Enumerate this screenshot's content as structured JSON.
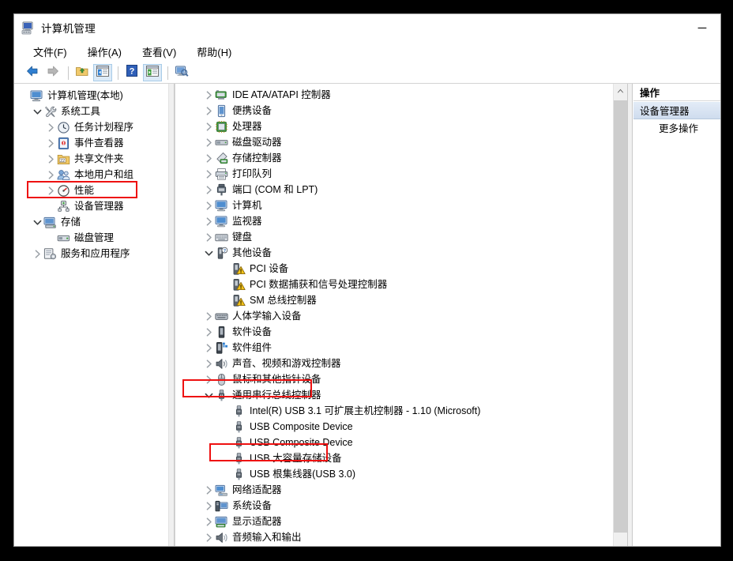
{
  "window": {
    "title": "计算机管理",
    "icon": "computer-management-icon",
    "minimize_label": "─"
  },
  "menu": [
    {
      "name": "file",
      "label": "文件(F)",
      "accel": "F"
    },
    {
      "name": "action",
      "label": "操作(A)",
      "accel": "A"
    },
    {
      "name": "view",
      "label": "查看(V)",
      "accel": "V"
    },
    {
      "name": "help",
      "label": "帮助(H)",
      "accel": "H"
    }
  ],
  "toolbar": [
    {
      "name": "back-icon",
      "tooltip": "后退"
    },
    {
      "name": "forward-icon",
      "tooltip": "前进"
    },
    {
      "name": "up-folder-icon",
      "tooltip": "向上一层"
    },
    {
      "name": "show-console-tree-icon",
      "tooltip": "显示/隐藏控制台树",
      "active": true
    },
    {
      "name": "help-icon",
      "tooltip": "帮助"
    },
    {
      "name": "show-action-pane-icon",
      "tooltip": "显示/隐藏操作窗格",
      "active": true
    },
    {
      "name": "scan-hardware-icon",
      "tooltip": "扫描检测硬件改动"
    }
  ],
  "console_tree": [
    {
      "label": "计算机管理(本地)",
      "depth": 0,
      "state": "none",
      "icon": "computer-management-icon"
    },
    {
      "label": "系统工具",
      "depth": 1,
      "state": "expanded",
      "icon": "system-tools-icon"
    },
    {
      "label": "任务计划程序",
      "depth": 2,
      "state": "collapsed",
      "icon": "task-scheduler-icon"
    },
    {
      "label": "事件查看器",
      "depth": 2,
      "state": "collapsed",
      "icon": "event-viewer-icon"
    },
    {
      "label": "共享文件夹",
      "depth": 2,
      "state": "collapsed",
      "icon": "shared-folders-icon"
    },
    {
      "label": "本地用户和组",
      "depth": 2,
      "state": "collapsed",
      "icon": "local-users-groups-icon"
    },
    {
      "label": "性能",
      "depth": 2,
      "state": "collapsed",
      "icon": "performance-icon"
    },
    {
      "label": "设备管理器",
      "depth": 2,
      "state": "none",
      "icon": "device-manager-icon",
      "highlighted": true
    },
    {
      "label": "存储",
      "depth": 1,
      "state": "expanded",
      "icon": "storage-icon"
    },
    {
      "label": "磁盘管理",
      "depth": 2,
      "state": "none",
      "icon": "disk-management-icon"
    },
    {
      "label": "服务和应用程序",
      "depth": 1,
      "state": "collapsed",
      "icon": "services-applications-icon"
    }
  ],
  "device_tree": [
    {
      "label": "IDE ATA/ATAPI 控制器",
      "depth": 1,
      "state": "collapsed",
      "icon": "ide-controller-icon"
    },
    {
      "label": "便携设备",
      "depth": 1,
      "state": "collapsed",
      "icon": "portable-device-icon"
    },
    {
      "label": "处理器",
      "depth": 1,
      "state": "collapsed",
      "icon": "processor-icon"
    },
    {
      "label": "磁盘驱动器",
      "depth": 1,
      "state": "collapsed",
      "icon": "disk-drive-icon"
    },
    {
      "label": "存储控制器",
      "depth": 1,
      "state": "collapsed",
      "icon": "storage-controller-icon"
    },
    {
      "label": "打印队列",
      "depth": 1,
      "state": "collapsed",
      "icon": "print-queue-icon"
    },
    {
      "label": "端口 (COM 和 LPT)",
      "depth": 1,
      "state": "collapsed",
      "icon": "port-icon"
    },
    {
      "label": "计算机",
      "depth": 1,
      "state": "collapsed",
      "icon": "computer-icon"
    },
    {
      "label": "监视器",
      "depth": 1,
      "state": "collapsed",
      "icon": "monitor-icon"
    },
    {
      "label": "键盘",
      "depth": 1,
      "state": "collapsed",
      "icon": "keyboard-icon"
    },
    {
      "label": "其他设备",
      "depth": 1,
      "state": "expanded",
      "icon": "other-devices-icon"
    },
    {
      "label": "PCI 设备",
      "depth": 2,
      "state": "none",
      "icon": "unknown-device-warning-icon"
    },
    {
      "label": "PCI 数据捕获和信号处理控制器",
      "depth": 2,
      "state": "none",
      "icon": "unknown-device-warning-icon"
    },
    {
      "label": "SM 总线控制器",
      "depth": 2,
      "state": "none",
      "icon": "unknown-device-warning-icon"
    },
    {
      "label": "人体学输入设备",
      "depth": 1,
      "state": "collapsed",
      "icon": "hid-icon"
    },
    {
      "label": "软件设备",
      "depth": 1,
      "state": "collapsed",
      "icon": "software-device-icon"
    },
    {
      "label": "软件组件",
      "depth": 1,
      "state": "collapsed",
      "icon": "software-component-icon"
    },
    {
      "label": "声音、视频和游戏控制器",
      "depth": 1,
      "state": "collapsed",
      "icon": "sound-video-game-icon"
    },
    {
      "label": "鼠标和其他指针设备",
      "depth": 1,
      "state": "collapsed",
      "icon": "mouse-icon"
    },
    {
      "label": "通用串行总线控制器",
      "depth": 1,
      "state": "expanded",
      "icon": "usb-icon",
      "highlighted": true
    },
    {
      "label": "Intel(R) USB 3.1 可扩展主机控制器 - 1.10 (Microsoft)",
      "depth": 2,
      "state": "none",
      "icon": "usb-icon"
    },
    {
      "label": "USB Composite Device",
      "depth": 2,
      "state": "none",
      "icon": "usb-icon"
    },
    {
      "label": "USB Composite Device",
      "depth": 2,
      "state": "none",
      "icon": "usb-icon"
    },
    {
      "label": "USB 大容量存储设备",
      "depth": 2,
      "state": "none",
      "icon": "usb-icon",
      "highlighted": true
    },
    {
      "label": "USB 根集线器(USB 3.0)",
      "depth": 2,
      "state": "none",
      "icon": "usb-icon"
    },
    {
      "label": "网络适配器",
      "depth": 1,
      "state": "collapsed",
      "icon": "network-adapter-icon"
    },
    {
      "label": "系统设备",
      "depth": 1,
      "state": "collapsed",
      "icon": "system-device-icon"
    },
    {
      "label": "显示适配器",
      "depth": 1,
      "state": "collapsed",
      "icon": "display-adapter-icon"
    },
    {
      "label": "音频输入和输出",
      "depth": 1,
      "state": "collapsed",
      "icon": "audio-io-icon"
    }
  ],
  "actions_pane": {
    "header": "操作",
    "selected_item": "设备管理器",
    "more_actions": "更多操作"
  },
  "colors": {
    "annotation": "#ee1111",
    "selection": "#cfdcee",
    "window_bg": "#f0f0f0",
    "pane_bg": "#ffffff"
  }
}
